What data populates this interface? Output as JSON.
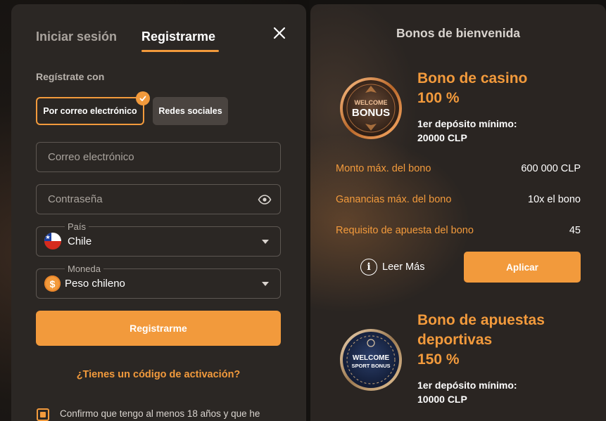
{
  "auth": {
    "tabs": {
      "login": "Iniciar sesión",
      "register": "Registrarme"
    },
    "section_label": "Regístrate con",
    "methods": {
      "email": "Por correo electrónico",
      "social": "Redes sociales"
    },
    "email_placeholder": "Correo electrónico",
    "password_placeholder": "Contraseña",
    "country": {
      "label": "País",
      "value": "Chile"
    },
    "currency": {
      "label": "Moneda",
      "value": "Peso chileno",
      "symbol": "$"
    },
    "register_button": "Registrarme",
    "activation_link": "¿Tienes un código de activación?",
    "age_confirm": "Confirmo que tengo al menos 18 años y que he"
  },
  "bonuses": {
    "title": "Bonos de bienvenida",
    "casino": {
      "badge_line1": "WELCOME",
      "badge_line2": "BONUS",
      "title": "Bono de casino",
      "percent": "100 %",
      "deposit_line1": "1er depósito mínimo:",
      "deposit_line2": "20000 CLP",
      "rows": [
        {
          "label": "Monto máx. del bono",
          "value": "600 000 CLP"
        },
        {
          "label": "Ganancias máx. del bono",
          "value": "10x el bono"
        },
        {
          "label": "Requisito de apuesta del bono",
          "value": "45"
        }
      ],
      "read_more": "Leer Más",
      "apply": "Aplicar"
    },
    "sport": {
      "badge_line1": "WELCOME",
      "badge_line2": "SPORT BONUS",
      "title_line1": "Bono de apuestas",
      "title_line2": "deportivas",
      "percent": "150 %",
      "deposit_line1": "1er depósito mínimo:",
      "deposit_line2": "10000 CLP"
    }
  },
  "colors": {
    "accent": "#f29a3c",
    "panel": "#2b2724",
    "field_border": "#5d5752"
  },
  "icons": [
    "close-icon",
    "check-icon",
    "eye-icon",
    "chile-flag-icon",
    "coin-icon",
    "caret-down-icon",
    "info-icon"
  ]
}
